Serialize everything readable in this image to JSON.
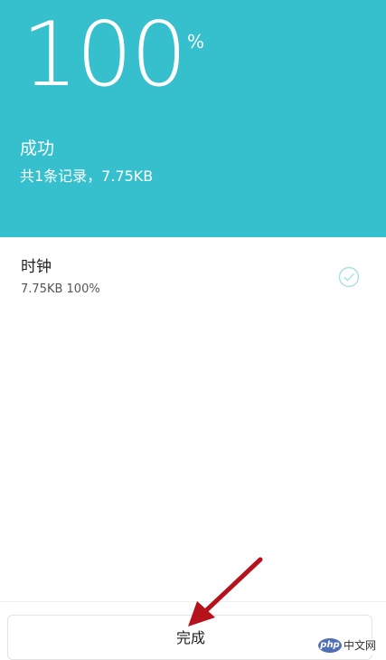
{
  "header": {
    "percent": "100",
    "percent_sign": "%",
    "status": "成功",
    "summary": "共1条记录，7.75KB"
  },
  "list": {
    "items": [
      {
        "name": "时钟",
        "meta": "7.75KB 100%",
        "icon": "check-circle-icon"
      }
    ]
  },
  "footer": {
    "done_label": "完成"
  },
  "watermark": {
    "logo": "php",
    "text": "中文网"
  },
  "colors": {
    "header_bg": "#36c0ce",
    "check": "#a8dfe4",
    "arrow": "#b5121b"
  }
}
